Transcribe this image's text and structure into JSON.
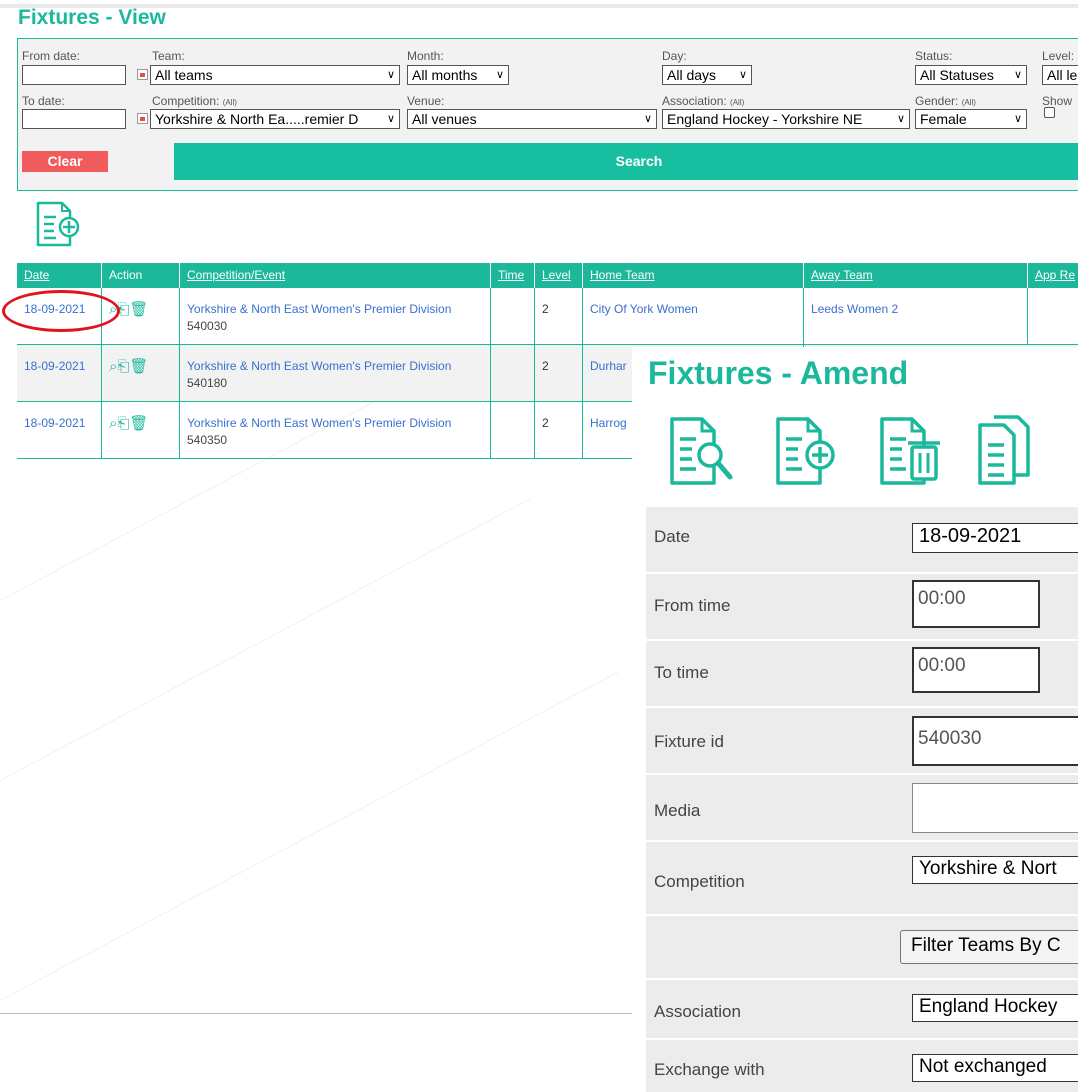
{
  "view": {
    "title": "Fixtures - View",
    "filters": {
      "from_date_label": "From date:",
      "from_date_value": "",
      "to_date_label": "To date:",
      "to_date_value": "",
      "team_label": "Team:",
      "team_value": "All teams",
      "competition_label": "Competition:",
      "competition_note": "(All)",
      "competition_value": "Yorkshire & North Ea.....remier D",
      "month_label": "Month:",
      "month_value": "All months",
      "venue_label": "Venue:",
      "venue_value": "All venues",
      "day_label": "Day:",
      "day_value": "All days",
      "association_label": "Association:",
      "association_note": "(All)",
      "association_value": "England Hockey - Yorkshire NE",
      "status_label": "Status:",
      "status_value": "All Statuses",
      "gender_label": "Gender:",
      "gender_note": "(All)",
      "gender_value": "Female",
      "level_label": "Level:",
      "level_value": "All le",
      "show_label": "Show",
      "clear_label": "Clear",
      "search_label": "Search"
    },
    "add_icon": "document-plus-icon",
    "table": {
      "headers": [
        "Date",
        "Action",
        "Competition/Event",
        "Time",
        "Level",
        "Home Team",
        "Away Team",
        "App Re"
      ],
      "rows": [
        {
          "date": "18-09-2021",
          "competition": "Yorkshire & North East Women's Premier Division",
          "id": "540030",
          "time": "",
          "level": "2",
          "home": "City Of York Women",
          "away": "Leeds Women 2"
        },
        {
          "date": "18-09-2021",
          "competition": "Yorkshire & North East Women's Premier Division",
          "id": "540180",
          "time": "",
          "level": "2",
          "home": "Durhar",
          "away": ""
        },
        {
          "date": "18-09-2021",
          "competition": "Yorkshire & North East Women's Premier Division",
          "id": "540350",
          "time": "",
          "level": "2",
          "home": "Harrog",
          "away": ""
        }
      ]
    }
  },
  "amend": {
    "title": "Fixtures - Amend",
    "icons": [
      "document-search-icon",
      "document-plus-icon",
      "document-trash-icon",
      "document-copy-icon"
    ],
    "fields": {
      "date_label": "Date",
      "date_value": "18-09-2021",
      "from_time_label": "From time",
      "from_time_value": "00:00",
      "to_time_label": "To time",
      "to_time_value": "00:00",
      "fixture_id_label": "Fixture id",
      "fixture_id_value": "540030",
      "media_label": "Media",
      "media_value": "",
      "competition_label": "Competition",
      "competition_value": "Yorkshire & Nort",
      "filter_button_label": "Filter Teams By C",
      "association_label": "Association",
      "association_value": "England Hockey",
      "exchange_label": "Exchange with",
      "exchange_value": "Not exchanged"
    }
  },
  "colors": {
    "accent": "#1bb89c",
    "search": "#17bfa0",
    "clear": "#f25b5b",
    "link": "#3a6fcf",
    "highlight": "#e0141e"
  }
}
